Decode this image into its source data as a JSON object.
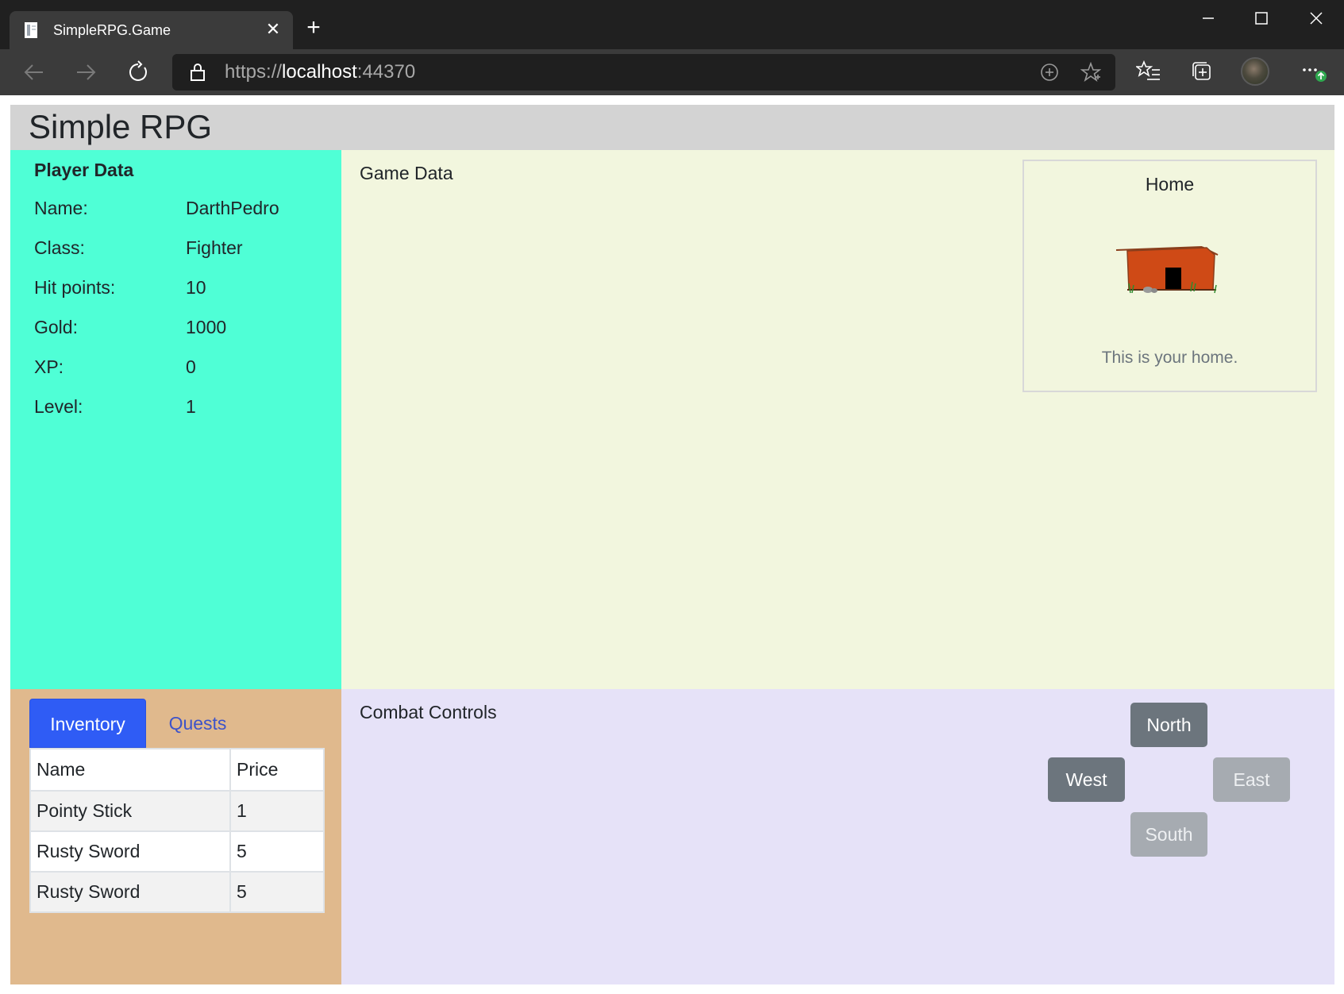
{
  "browser": {
    "tab_title": "SimpleRPG.Game",
    "url_scheme": "https://",
    "url_host": "localhost",
    "url_port": ":44370"
  },
  "app": {
    "title": "Simple RPG"
  },
  "player": {
    "heading": "Player Data",
    "rows": [
      {
        "label": "Name:",
        "value": "DarthPedro"
      },
      {
        "label": "Class:",
        "value": "Fighter"
      },
      {
        "label": "Hit points:",
        "value": "10"
      },
      {
        "label": "Gold:",
        "value": "1000"
      },
      {
        "label": "XP:",
        "value": "0"
      },
      {
        "label": "Level:",
        "value": "1"
      }
    ]
  },
  "game": {
    "heading": "Game Data",
    "location": {
      "name": "Home",
      "description": "This is your home.",
      "image_icon": "house-icon"
    }
  },
  "inventory": {
    "tabs": [
      {
        "label": "Inventory",
        "active": true
      },
      {
        "label": "Quests",
        "active": false
      }
    ],
    "columns": [
      "Name",
      "Price"
    ],
    "rows": [
      [
        "Pointy Stick",
        "1"
      ],
      [
        "Rusty Sword",
        "5"
      ],
      [
        "Rusty Sword",
        "5"
      ]
    ]
  },
  "combat": {
    "heading": "Combat Controls",
    "buttons": {
      "north": {
        "label": "North",
        "enabled": true
      },
      "west": {
        "label": "West",
        "enabled": true
      },
      "east": {
        "label": "East",
        "enabled": false
      },
      "south": {
        "label": "South",
        "enabled": false
      }
    }
  },
  "colors": {
    "player_panel": "#4fffd6",
    "game_panel": "#f2f6de",
    "inventory_panel": "#e0b98d",
    "combat_panel": "#e6e2f8",
    "header": "#d3d3d3",
    "active_tab": "#2f5cf5"
  }
}
